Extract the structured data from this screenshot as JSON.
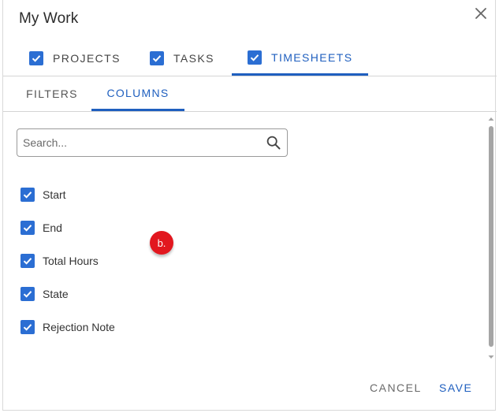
{
  "dialog": {
    "title": "My Work",
    "close_icon": "close-icon"
  },
  "main_tabs": [
    {
      "label": "PROJECTS",
      "checked": true,
      "active": false
    },
    {
      "label": "TASKS",
      "checked": true,
      "active": false
    },
    {
      "label": "TIMESHEETS",
      "checked": true,
      "active": true
    }
  ],
  "sub_tabs": [
    {
      "label": "FILTERS",
      "active": false
    },
    {
      "label": "COLUMNS",
      "active": true
    }
  ],
  "search": {
    "placeholder": "Search...",
    "value": "",
    "icon": "search-icon"
  },
  "columns": [
    {
      "label": "Start",
      "checked": true
    },
    {
      "label": "End",
      "checked": true
    },
    {
      "label": "Total Hours",
      "checked": true
    },
    {
      "label": "State",
      "checked": true
    },
    {
      "label": "Rejection Note",
      "checked": true
    }
  ],
  "badge": {
    "label": "b."
  },
  "footer": {
    "cancel_label": "CANCEL",
    "save_label": "SAVE"
  },
  "colors": {
    "accent": "#1f5fbf",
    "checkbox": "#2b6ed3",
    "badge": "#e2171f"
  }
}
